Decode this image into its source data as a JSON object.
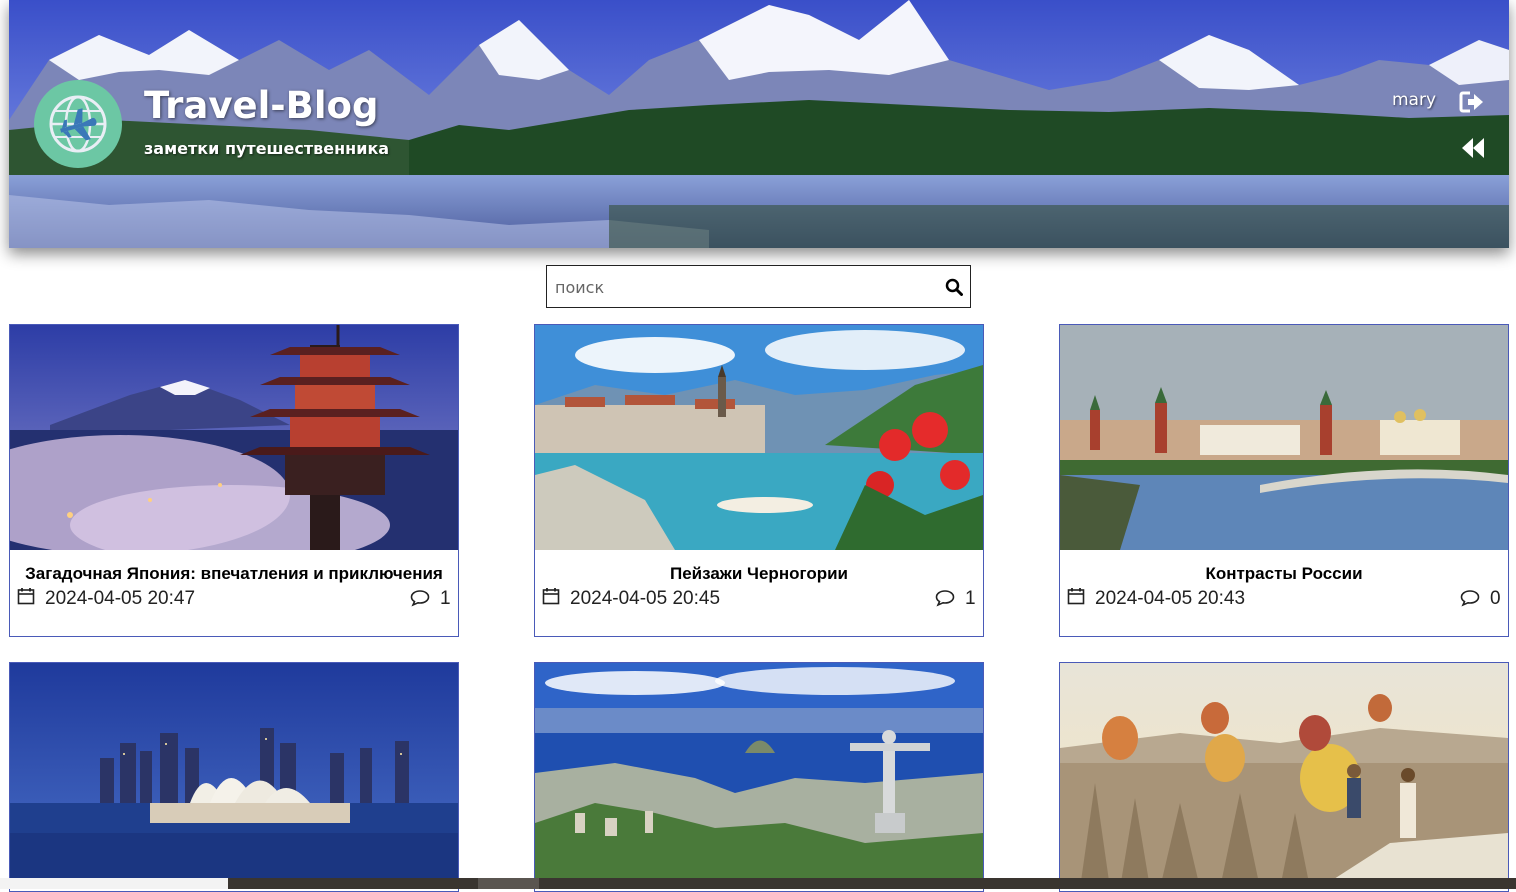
{
  "header": {
    "title": "Travel-Blog",
    "subtitle": "заметки путешественника",
    "user": "mary",
    "icons": [
      "plane-globe-logo-icon",
      "logout-icon",
      "back-icon"
    ]
  },
  "search": {
    "placeholder": "поиск",
    "value": ""
  },
  "posts": [
    {
      "title": "Загадочная Япония: впечатления и приключения",
      "date": "2024-04-05 20:47",
      "comments": "1",
      "image": "japan-pagoda-fuji"
    },
    {
      "title": "Пейзажи Черногории",
      "date": "2024-04-05 20:45",
      "comments": "1",
      "image": "montenegro-bay"
    },
    {
      "title": "Контрасты России",
      "date": "2024-04-05 20:43",
      "comments": "0",
      "image": "moscow-kremlin"
    },
    {
      "image": "sydney-opera-house"
    },
    {
      "image": "rio-christ-redeemer"
    },
    {
      "image": "cappadocia-balloons"
    }
  ],
  "colors": {
    "card_border": "#4a5ab8",
    "logo_bg": "#6cc7a4"
  }
}
